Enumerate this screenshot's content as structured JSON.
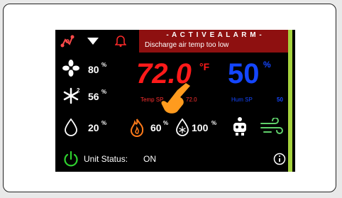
{
  "alarm": {
    "title": "- A C T I V E  A L A R M -",
    "message": "Discharge air temp too low"
  },
  "readings": {
    "fan_pct": "80",
    "cool_pct": "56",
    "water_pct": "20",
    "heat_pct": "60",
    "humidifier_pct": "100",
    "pct_symbol": "%"
  },
  "temperature": {
    "value": "72.0",
    "unit": "°F",
    "sp_label": "Temp SP",
    "sp_value": "72.0"
  },
  "humidity": {
    "value": "50",
    "unit": "%",
    "sp_label": "Hum SP",
    "sp_value": "50"
  },
  "status": {
    "label": "Unit Status:",
    "value": "ON"
  },
  "colors": {
    "alarm_bg": "#8e1010",
    "temp": "#ff1a1a",
    "humidity": "#1446ff",
    "power": "#2fd12f",
    "accent_strip": "#a6d33c"
  },
  "icons": [
    "network-off-icon",
    "dropdown-arrow-icon",
    "bell-icon",
    "fan-icon",
    "snowflake-icon",
    "water-drop-icon",
    "flame-icon",
    "humidifier-drop-icon",
    "service-robot-icon",
    "airflow-icon",
    "power-icon",
    "info-icon",
    "hand-pointer-icon"
  ]
}
